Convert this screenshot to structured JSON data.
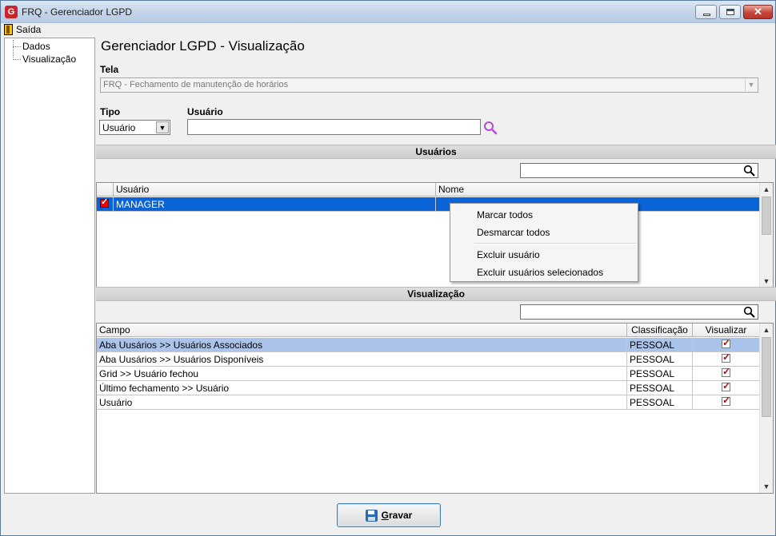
{
  "window": {
    "title": "FRQ - Gerenciador LGPD",
    "icon_letter": "G"
  },
  "menu": {
    "exit_label": "Saída"
  },
  "tree": {
    "items": [
      {
        "label": "Dados"
      },
      {
        "label": "Visualização"
      }
    ]
  },
  "page": {
    "title": "Gerenciador LGPD - Visualização"
  },
  "form": {
    "tela_label": "Tela",
    "tela_value": "FRQ - Fechamento de manutenção de horários",
    "tipo_label": "Tipo",
    "tipo_value": "Usuário",
    "usuario_label": "Usuário",
    "usuario_value": ""
  },
  "usuarios": {
    "section_title": "Usuários",
    "search_value": "",
    "columns": [
      "Usuário",
      "Nome"
    ],
    "rows": [
      {
        "checked": true,
        "usuario": "MANAGER",
        "nome": ""
      }
    ]
  },
  "context_menu": {
    "items": [
      "Marcar todos",
      "Desmarcar todos",
      "Excluir usuário",
      "Excluir usuários selecionados"
    ]
  },
  "visualizacao": {
    "section_title": "Visualização",
    "search_value": "",
    "columns": [
      "Campo",
      "Classificação",
      "Visualizar"
    ],
    "rows": [
      {
        "campo": "Aba Uusários >> Usuários Associados",
        "classificacao": "PESSOAL",
        "visualizar": true
      },
      {
        "campo": "Aba Uusários >> Usuários Disponíveis",
        "classificacao": "PESSOAL",
        "visualizar": true
      },
      {
        "campo": "Grid >> Usuário fechou",
        "classificacao": "PESSOAL",
        "visualizar": true
      },
      {
        "campo": "Último fechamento >> Usuário",
        "classificacao": "PESSOAL",
        "visualizar": true
      },
      {
        "campo": "Usuário",
        "classificacao": "PESSOAL",
        "visualizar": true
      }
    ]
  },
  "footer": {
    "save_prefix": "G",
    "save_rest": "ravar"
  },
  "colors": {
    "selection": "#0a64d8",
    "selection_light": "#aac3ea",
    "check": "#d00000",
    "title_icon": "#c8262c"
  }
}
